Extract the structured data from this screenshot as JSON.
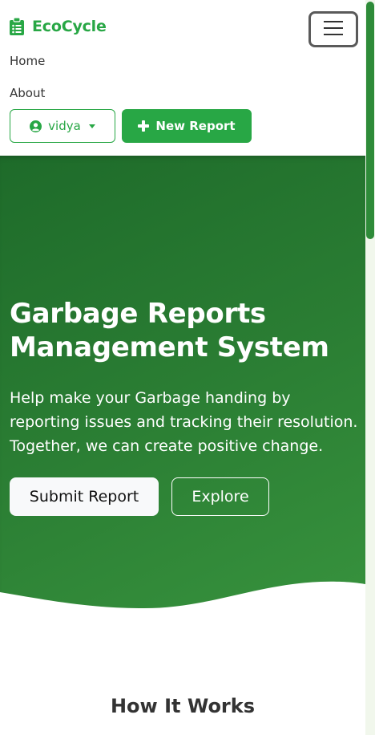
{
  "navbar": {
    "brand": "EcoCycle",
    "brand_icon": "clipboard-list-icon",
    "nav_links": [
      "Home",
      "About"
    ],
    "user_button": {
      "label": "vidya",
      "icon": "user-circle-icon"
    },
    "new_report_button": {
      "label": "New Report",
      "icon": "plus-icon"
    },
    "accent_color": "#28a745"
  },
  "hero": {
    "title_line1": "Garbage Reports",
    "title_line2": "Management System",
    "subtitle": "Help make your Garbage handing by reporting issues and tracking their resolution. Together, we can create positive change.",
    "submit_button": "Submit Report",
    "explore_button": "Explore",
    "background_color": "#2a7d33"
  },
  "how_it_works": {
    "title": "How It Works"
  }
}
